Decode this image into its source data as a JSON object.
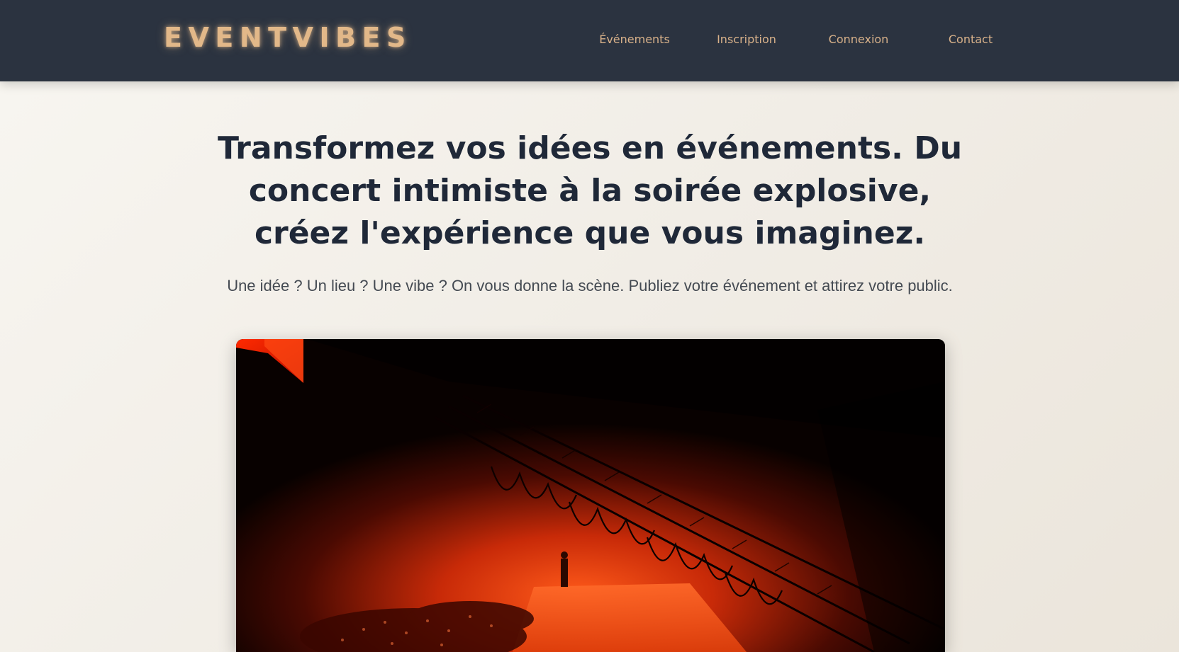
{
  "header": {
    "logo": "EVENTVIBES",
    "nav": [
      {
        "label": "Événements"
      },
      {
        "label": "Inscription"
      },
      {
        "label": "Connexion"
      },
      {
        "label": "Contact"
      }
    ]
  },
  "hero": {
    "title": "Transformez vos idées en événements. Du concert intimiste à la soirée explosive, créez l'expérience que vous imaginez.",
    "subtitle": "Une idée ? Un lieu ? Une vibe ? On vous donne la scène. Publiez votre événement et attirez votre public."
  },
  "colors": {
    "navbar_bg": "#2b3340",
    "accent": "#e2b889",
    "heading": "#1f2838",
    "page_bg": "#f3f0ea"
  }
}
